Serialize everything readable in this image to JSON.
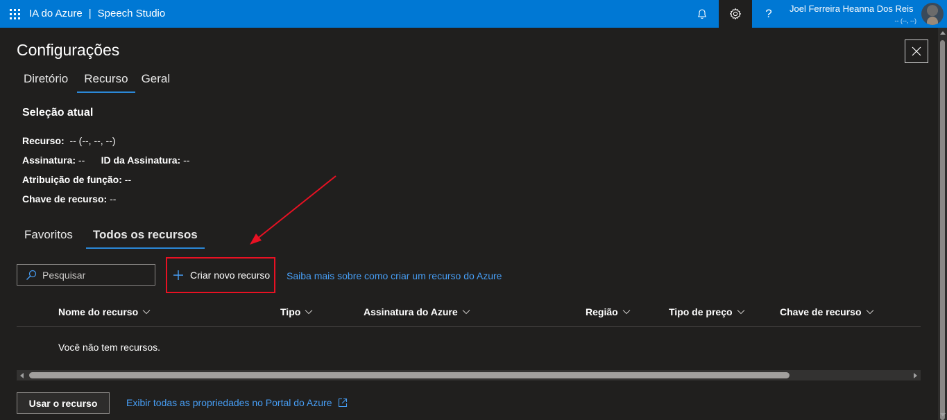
{
  "header": {
    "app_name": "IA do Azure",
    "separator": "|",
    "product_name": "Speech Studio",
    "user_name": "Joel Ferreira Heanna Dos Reis",
    "user_subtext": "-- (--, --)",
    "help_label": "?"
  },
  "panel": {
    "title": "Configurações",
    "close_icon": "close-icon"
  },
  "settings_tabs": [
    {
      "label": "Diretório",
      "active": false
    },
    {
      "label": "Recurso",
      "active": true
    },
    {
      "label": "Geral",
      "active": false
    }
  ],
  "current_selection": {
    "title": "Seleção atual",
    "resource_label": "Recurso:",
    "resource_value": "-- (--, --, --)",
    "subscription_label": "Assinatura:",
    "subscription_value": "--",
    "subscription_id_label": "ID da Assinatura:",
    "subscription_id_value": "--",
    "role_label": "Atribuição de função:",
    "role_value": "--",
    "key_label": "Chave de recurso:",
    "key_value": "--"
  },
  "resource_tabs": [
    {
      "label": "Favoritos",
      "active": false
    },
    {
      "label": "Todos os recursos",
      "active": true
    }
  ],
  "toolbar": {
    "search_placeholder": "Pesquisar",
    "create_label": "Criar novo recurso",
    "learn_link": "Saiba mais sobre como criar um recurso do Azure"
  },
  "table": {
    "columns": [
      "Nome do recurso",
      "Tipo",
      "Assinatura do Azure",
      "Região",
      "Tipo de preço",
      "Chave de recurso"
    ],
    "empty_message": "Você não tem recursos."
  },
  "footer": {
    "use_button": "Usar o recurso",
    "portal_link": "Exibir todas as propriedades no Portal do Azure"
  },
  "colors": {
    "topbar": "#0078d4",
    "background": "#201f1e",
    "accent_underline": "#2b88d8",
    "link": "#479ef5",
    "annotation": "#e81123"
  }
}
